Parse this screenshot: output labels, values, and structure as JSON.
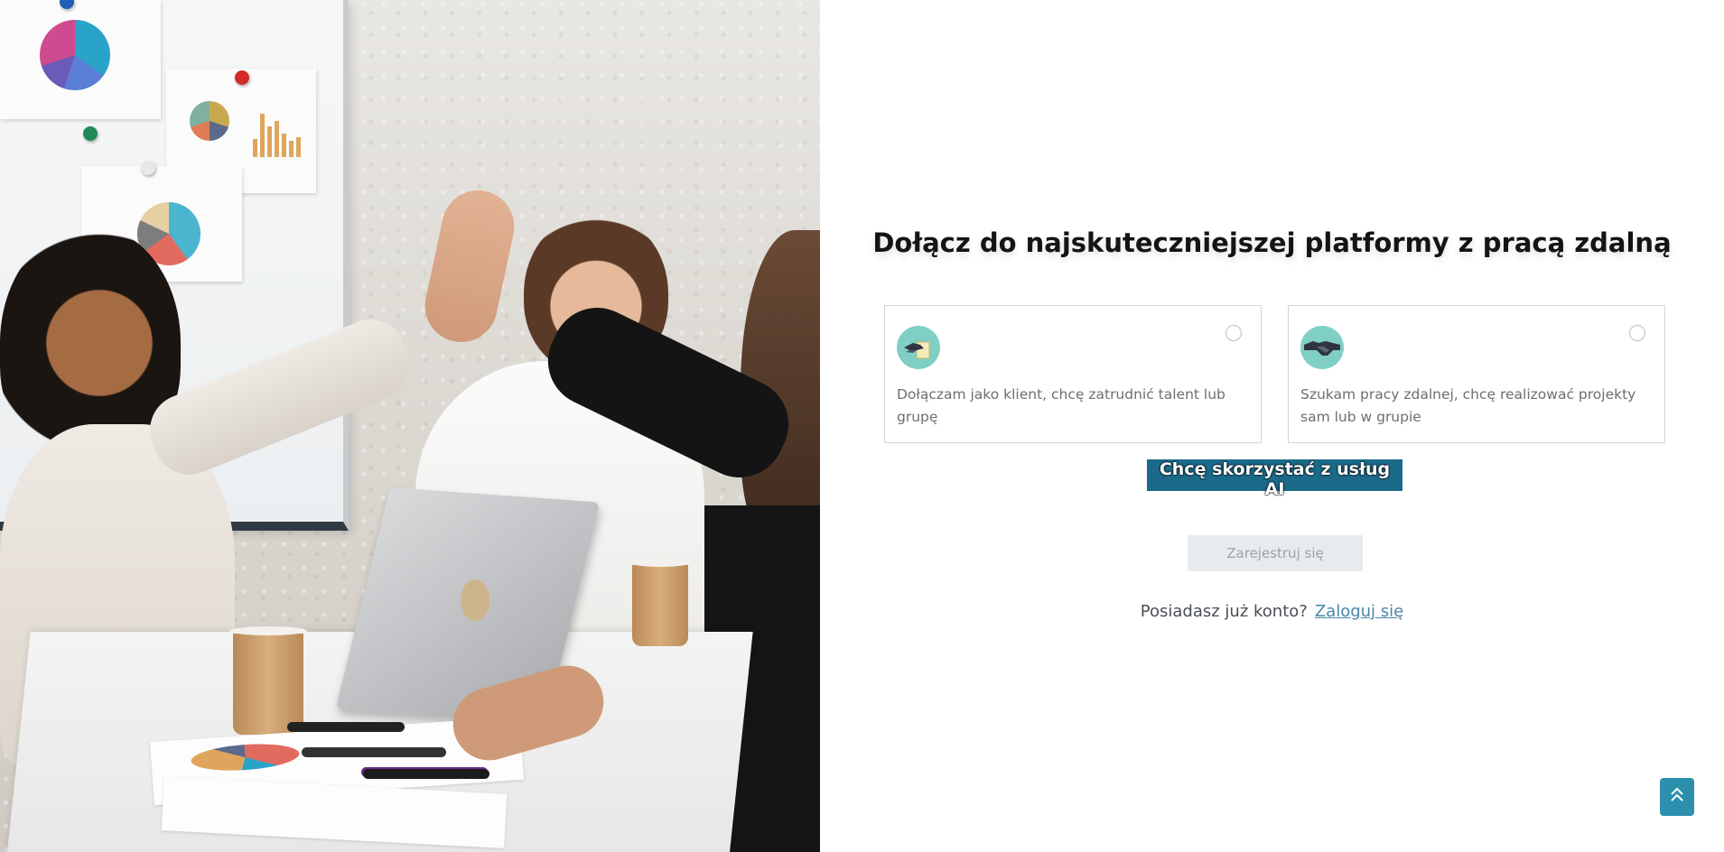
{
  "heading": "Dołącz do najskuteczniejszej platformy z pracą zdalną",
  "options": [
    {
      "id": "client",
      "icon": "handshake-document-icon",
      "text": "Dołączam jako klient, chcę zatrudnić talent lub grupę"
    },
    {
      "id": "freelancer",
      "icon": "handshake-icon",
      "text": "Szukam pracy zdalnej, chcę realizować projekty sam lub w grupie"
    }
  ],
  "ai_button_label": "Chcę skorzystać z usług AI",
  "register_button_label": "Zarejestruj się",
  "login": {
    "question": "Posiadasz już konto?",
    "link_label": "Zaloguj się"
  },
  "scroll_top_icon": "double-chevron-up-icon",
  "colors": {
    "accent": "#1b6a8a",
    "icon_bg": "#7fcfc4",
    "link": "#4a86a8",
    "scroll_button": "#2c8fae"
  }
}
